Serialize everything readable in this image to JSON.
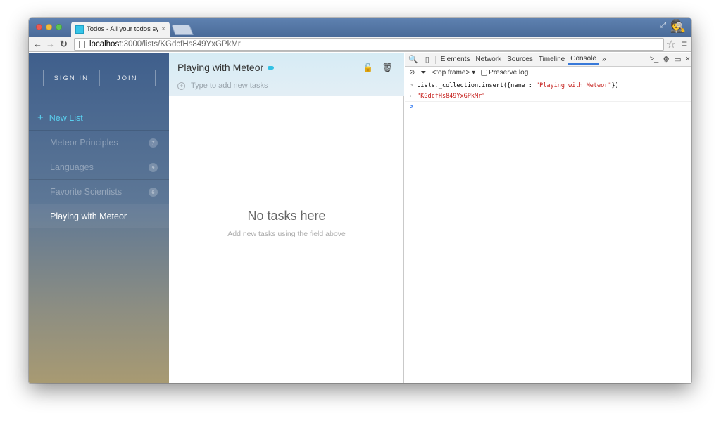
{
  "browser": {
    "tab_title": "Todos - All your todos syn",
    "tab_close": "×",
    "url_host": "localhost",
    "url_path": ":3000/lists/KGdcfHs849YxGPkMr"
  },
  "sidebar": {
    "sign_in": "SIGN IN",
    "join": "JOIN",
    "new_list": "New List",
    "items": [
      {
        "label": "Meteor Principles",
        "count": "7"
      },
      {
        "label": "Languages",
        "count": "9"
      },
      {
        "label": "Favorite Scientists",
        "count": "6"
      },
      {
        "label": "Playing with Meteor",
        "count": ""
      }
    ]
  },
  "main": {
    "list_title": "Playing with Meteor",
    "add_task_placeholder": "Type to add new tasks",
    "empty_title": "No tasks here",
    "empty_subtitle": "Add new tasks using the field above"
  },
  "devtools": {
    "tabs": [
      "Elements",
      "Network",
      "Sources",
      "Timeline",
      "Console"
    ],
    "more": "»",
    "frame_select": "<top frame>",
    "preserve_log": "Preserve log",
    "console_input_code": "Lists._collection.insert({name : ",
    "console_input_string": "\"Playing with Meteor\"",
    "console_input_end": "})",
    "console_output": "\"KGdcfHs849YxGPkMr\""
  },
  "colors": {
    "accent": "#33c1e4",
    "sidebar_top": "#3f5f8c",
    "sidebar_bottom": "#a89a72"
  }
}
